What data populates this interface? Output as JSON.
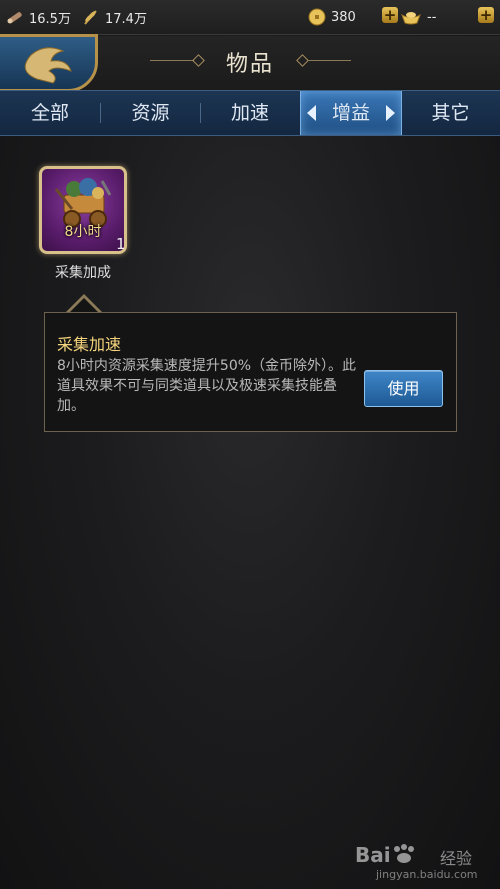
{
  "resources": {
    "wood": {
      "icon": "log-icon",
      "value": "16.5万"
    },
    "food": {
      "icon": "wheat-icon",
      "value": "17.4万"
    },
    "gold": {
      "icon": "gold-coin-icon",
      "value": "380"
    },
    "ingot": {
      "icon": "gold-ingot-icon",
      "value": "--"
    }
  },
  "header": {
    "title": "物品"
  },
  "tabs": [
    {
      "label": "全部",
      "active": false
    },
    {
      "label": "资源",
      "active": false
    },
    {
      "label": "加速",
      "active": false
    },
    {
      "label": "增益",
      "active": true
    },
    {
      "label": "其它",
      "active": false
    }
  ],
  "item": {
    "overlay_label": "8小时",
    "count": "1",
    "name": "采集加成"
  },
  "detail": {
    "title": "采集加速",
    "description": "8小时内资源采集速度提升50%（金币除外）。此道具效果不可与同类道具以及极速采集技能叠加。",
    "use_button": "使用"
  },
  "watermark": {
    "brand": "Bai",
    "brand2": "经验",
    "url": "jingyan.baidu.com"
  },
  "colors": {
    "accent_blue": "#2a6aa8",
    "gold": "#f3d37c",
    "frame": "#d8c08a"
  }
}
